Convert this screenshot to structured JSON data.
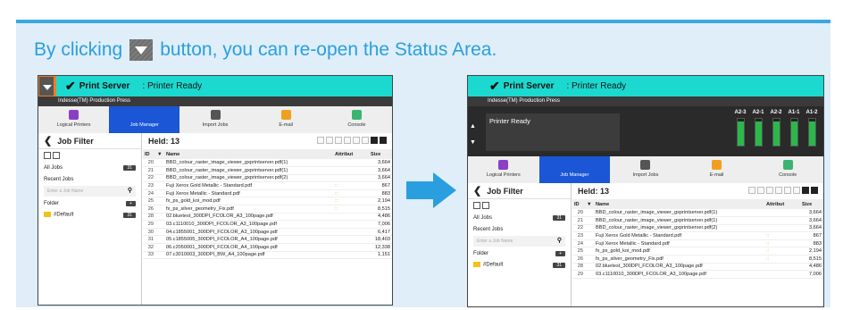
{
  "caption": {
    "before": "By clicking",
    "after": "button, you can re-open the Status Area."
  },
  "app": {
    "server_label": "Print Server",
    "status_label": ": Printer Ready",
    "product": "Indesse(TM) Production Press",
    "status_area_text": "Printer Ready"
  },
  "trays": [
    {
      "label": "A2-3",
      "level": 0.9
    },
    {
      "label": "A2-1",
      "level": 0.9
    },
    {
      "label": "A2-2",
      "level": 0.9
    },
    {
      "label": "A1-1",
      "level": 0.9
    },
    {
      "label": "A1-2",
      "level": 0.9
    }
  ],
  "nav": [
    {
      "label": "Logical Printers",
      "color": "#8b3fc6"
    },
    {
      "label": "Job Manager",
      "color": "#1a56d6"
    },
    {
      "label": "Import Jobs",
      "color": "#555555"
    },
    {
      "label": "E-mail",
      "color": "#f0a020"
    },
    {
      "label": "Console",
      "color": "#3cb371"
    }
  ],
  "sidebar": {
    "title": "Job Filter",
    "all_jobs": "All Jobs",
    "all_jobs_count": "31",
    "recent_jobs": "Recent Jobs",
    "search_placeholder": "Enter a Job Name",
    "folder": "Folder",
    "default_folder": "#Default",
    "default_count": "31"
  },
  "main": {
    "held": "Held: 13",
    "columns": {
      "id": "ID",
      "name": "Name",
      "attr": "Attribut",
      "size": "Size"
    }
  },
  "jobs": [
    {
      "id": "20",
      "name": "BBD_colour_raster_image_viewer_gxprintserver.pdf(1)",
      "attr": "",
      "size": "3,664"
    },
    {
      "id": "21",
      "name": "BBD_colour_raster_image_viewer_gxprintserver.pdf(1)",
      "attr": "",
      "size": "3,664"
    },
    {
      "id": "22",
      "name": "BBD_colour_raster_image_viewer_gxprintserver.pdf(2)",
      "attr": "",
      "size": "3,664"
    },
    {
      "id": "23",
      "name": "Fuji Xerox Gold Metallic - Standard.pdf",
      "attr": "::",
      "size": "867"
    },
    {
      "id": "24",
      "name": "Fuji Xerox Metallic - Standard.pdf",
      "attr": "::",
      "size": "883"
    },
    {
      "id": "25",
      "name": "fx_ps_gold_koi_mod.pdf",
      "attr": "::",
      "size": "2,194"
    },
    {
      "id": "26",
      "name": "fx_ps_silver_geometry_Fix.pdf",
      "attr": "::",
      "size": "8,515"
    },
    {
      "id": "28",
      "name": "02.bluetest_300DPI_FCOLOR_A3_100page.pdf",
      "attr": "",
      "size": "4,486"
    },
    {
      "id": "29",
      "name": "03.c1110010_300DPI_FCOLOR_A3_100page.pdf",
      "attr": "",
      "size": "7,006"
    },
    {
      "id": "30",
      "name": "04.c1855001_300DPI_FCOLOR_A3_100page.pdf",
      "attr": "",
      "size": "6,417"
    },
    {
      "id": "31",
      "name": "05.c1855005_300DPI_FCOLOR_A4_100page.pdf",
      "attr": "",
      "size": "18,403"
    },
    {
      "id": "32",
      "name": "06.c2050001_300DPI_FCOLOR_A4_100page.pdf",
      "attr": "",
      "size": "12,338"
    },
    {
      "id": "33",
      "name": "07.c3010003_300DPI_BW_A4_100page.pdf",
      "attr": "",
      "size": "1,151"
    }
  ],
  "colors": {
    "accent": "#2a9fdf",
    "titlebar": "#1cd9d0",
    "highlight": "#f27c1e",
    "active_nav": "#1a56d6"
  }
}
